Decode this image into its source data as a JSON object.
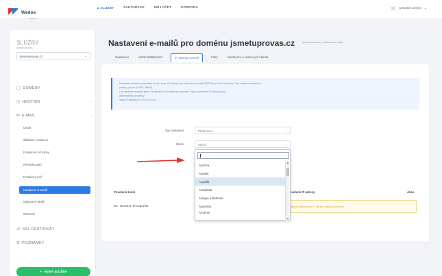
{
  "topbar": {
    "logo": "Wedos",
    "logo_sub": "server",
    "nav": [
      "SLUŽBY",
      "FAKTURACE",
      "MŮJ ÚČET",
      "PODPORA"
    ],
    "user": "Uzivatel Jmeno"
  },
  "sidebar": {
    "title": "SLUŽBY",
    "subtitle": "Jsmetuprovas",
    "selected_domain": "jsmetuprovas.cz",
    "sections": [
      {
        "label": "DOMÉNY",
        "icon": "globe-icon"
      },
      {
        "label": "HOSTING",
        "icon": "hosting-icon"
      },
      {
        "label": "E-MAIL",
        "icon": "mail-icon"
      }
    ],
    "email_items": [
      "Detail",
      "Základní nastavení",
      "E-Mailové Schránky",
      "Přesměrování",
      "E-Mailový Koš",
      "Nastavení E-Mailů",
      "Migrace E-Mailů",
      "Webmail"
    ],
    "extra_sections": [
      {
        "label": "SSL CERTIFIKÁT",
        "icon": "lock-icon"
      },
      {
        "label": "POZNÁMKY",
        "icon": "notes-icon"
      }
    ],
    "new_button": "NOVÁ SLUŽBA"
  },
  "main": {
    "title": "Nastavení e-mailů pro doménu jsmetuprovas.cz",
    "breadcrumb": "jsmetuprovas.cz / Nastavení e-mailů",
    "tabs": [
      "Nastavení",
      "Whitelist/Blacklist",
      "IP adresy a země",
      "Filtry",
      "Nastavení e-mailových klientů"
    ],
    "info_lines": [
      "Možnost omezit na povolené země, resp. IP adresy, pro odesílání e-mailů (SMTP) a čtení schránky. Toto nastavení platí pro",
      "přístup pouze (POP3, IMAP).",
      "Lze nastavit seznam zemí, ze kterých bude přístup umožněn. Navíc povolené IP adresy jsou",
      "automaticky povoleny.",
      "Vaše IP adresa je 213.57.82.44."
    ],
    "type_label": "Typ nastavení",
    "type_value": "Přidat zemi",
    "country_label": "Země",
    "country_placeholder": "Select",
    "dropdown_options": [
      "Andorra",
      "Anguila",
      "Anguilla",
      "Antarktida",
      "Antigua a Barbuda",
      "Argentina",
      "Arménie"
    ],
    "table": {
      "headers": [
        "Povolené země",
        "Povolené IP adresy",
        "Akce"
      ],
      "row_country": "BA - Bosna a Hercegovina",
      "ip_notice": "Nejsou definované IP adresy nejsou povoleny."
    }
  },
  "colors": {
    "accent": "#2c7be5",
    "success": "#2bbf6a",
    "warning": "#c9a23c",
    "arrow": "#e3342f"
  }
}
